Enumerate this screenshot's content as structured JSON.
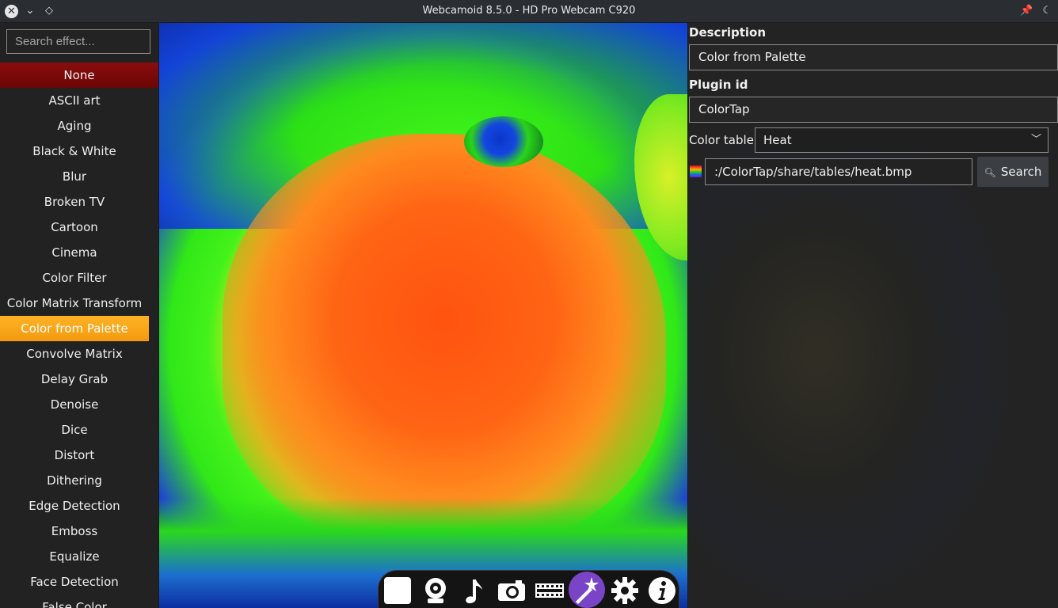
{
  "window": {
    "title": "Webcamoid 8.5.0 - HD Pro Webcam C920"
  },
  "sidebar": {
    "search_placeholder": "Search effect...",
    "effects": [
      {
        "label": "None"
      },
      {
        "label": "ASCII art"
      },
      {
        "label": "Aging"
      },
      {
        "label": "Black & White"
      },
      {
        "label": "Blur"
      },
      {
        "label": "Broken TV"
      },
      {
        "label": "Cartoon"
      },
      {
        "label": "Cinema"
      },
      {
        "label": "Color Filter"
      },
      {
        "label": "Color Matrix Transform"
      },
      {
        "label": "Color from Palette"
      },
      {
        "label": "Convolve Matrix"
      },
      {
        "label": "Delay Grab"
      },
      {
        "label": "Denoise"
      },
      {
        "label": "Dice"
      },
      {
        "label": "Distort"
      },
      {
        "label": "Dithering"
      },
      {
        "label": "Edge Detection"
      },
      {
        "label": "Emboss"
      },
      {
        "label": "Equalize"
      },
      {
        "label": "Face Detection"
      },
      {
        "label": "False Color"
      }
    ],
    "selected": "Color from Palette"
  },
  "details": {
    "description_label": "Description",
    "description_value": "Color from Palette",
    "plugin_id_label": "Plugin id",
    "plugin_id_value": "ColorTap",
    "color_table_label": "Color table",
    "color_table_value": "Heat",
    "table_path": ":/ColorTap/share/tables/heat.bmp",
    "search_button": "Search"
  },
  "dock": {
    "buttons": [
      {
        "icon": "stop-icon",
        "active": false
      },
      {
        "icon": "webcam-icon",
        "active": false
      },
      {
        "icon": "music-note-icon",
        "active": false
      },
      {
        "icon": "camera-icon",
        "active": false
      },
      {
        "icon": "film-strip-icon",
        "active": false
      },
      {
        "icon": "magic-wand-icon",
        "active": true
      },
      {
        "icon": "gear-icon",
        "active": false
      },
      {
        "icon": "info-icon",
        "active": false
      }
    ]
  },
  "colors": {
    "selected_effect": "#f9a51a",
    "none_effect": "#7a0a0a",
    "dock_active": "#7a44c6"
  }
}
